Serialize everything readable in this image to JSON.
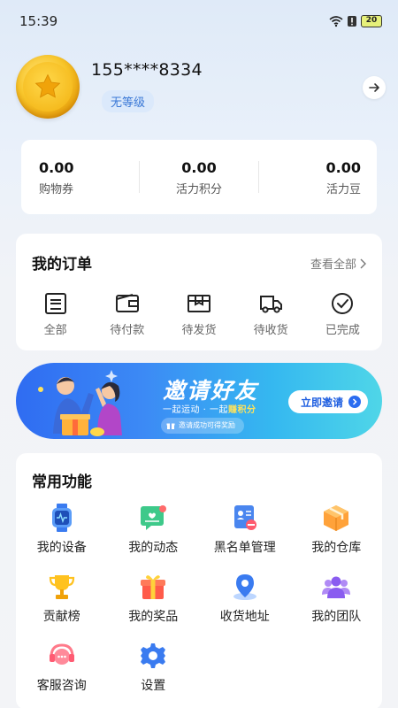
{
  "status_bar": {
    "time": "15:39",
    "battery": "20"
  },
  "profile": {
    "username": "155****8334",
    "level": "无等级"
  },
  "stats": [
    {
      "value": "0.00",
      "label": "购物券"
    },
    {
      "value": "0.00",
      "label": "活力积分"
    },
    {
      "value": "0.00",
      "label": "活力豆"
    }
  ],
  "orders": {
    "title": "我的订单",
    "view_all": "查看全部",
    "items": [
      {
        "label": "全部",
        "icon": "all-orders-icon"
      },
      {
        "label": "待付款",
        "icon": "wallet-icon"
      },
      {
        "label": "待发货",
        "icon": "package-icon"
      },
      {
        "label": "待收货",
        "icon": "truck-icon"
      },
      {
        "label": "已完成",
        "icon": "check-circle-icon"
      }
    ]
  },
  "banner": {
    "title": "邀请好友",
    "subtitle_part1": "一起运动 · 一起",
    "subtitle_highlight": "赚积分",
    "pill": "邀请成功可得奖励",
    "button": "立即邀请"
  },
  "functions": {
    "title": "常用功能",
    "items": [
      {
        "label": "我的设备",
        "icon": "smartwatch-icon"
      },
      {
        "label": "我的动态",
        "icon": "message-heart-icon"
      },
      {
        "label": "黑名单管理",
        "icon": "blacklist-icon"
      },
      {
        "label": "我的仓库",
        "icon": "warehouse-box-icon"
      },
      {
        "label": "贡献榜",
        "icon": "trophy-icon"
      },
      {
        "label": "我的奖品",
        "icon": "gift-icon"
      },
      {
        "label": "收货地址",
        "icon": "map-pin-icon"
      },
      {
        "label": "我的团队",
        "icon": "team-icon"
      },
      {
        "label": "客服咨询",
        "icon": "headset-icon"
      },
      {
        "label": "设置",
        "icon": "gear-icon"
      }
    ]
  }
}
